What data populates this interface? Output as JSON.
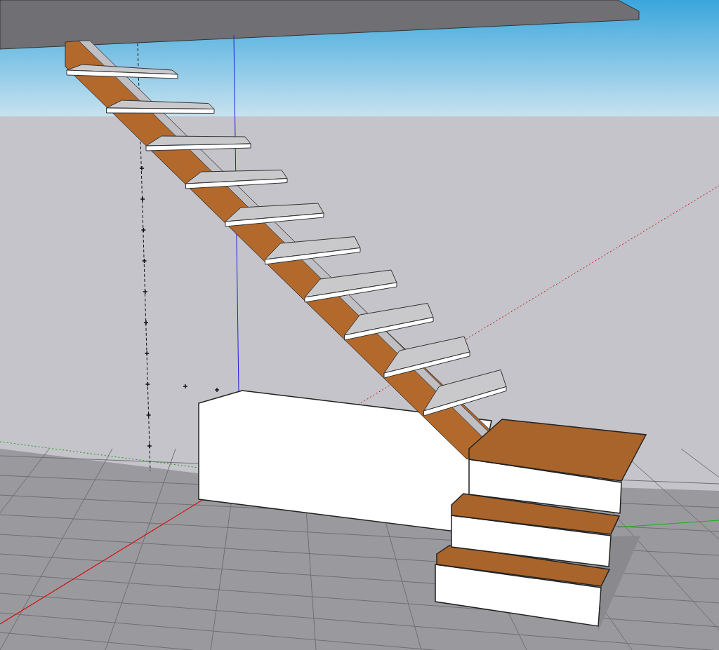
{
  "model": {
    "steps": [
      {
        "kind": "floating-tread"
      },
      {
        "kind": "floating-tread"
      },
      {
        "kind": "floating-tread"
      },
      {
        "kind": "floating-tread"
      },
      {
        "kind": "floating-tread"
      },
      {
        "kind": "floating-tread"
      },
      {
        "kind": "floating-tread"
      },
      {
        "kind": "floating-tread"
      },
      {
        "kind": "floating-tread"
      },
      {
        "kind": "floating-tread"
      },
      {
        "kind": "box-step"
      },
      {
        "kind": "box-step"
      },
      {
        "kind": "box-step"
      }
    ]
  }
}
